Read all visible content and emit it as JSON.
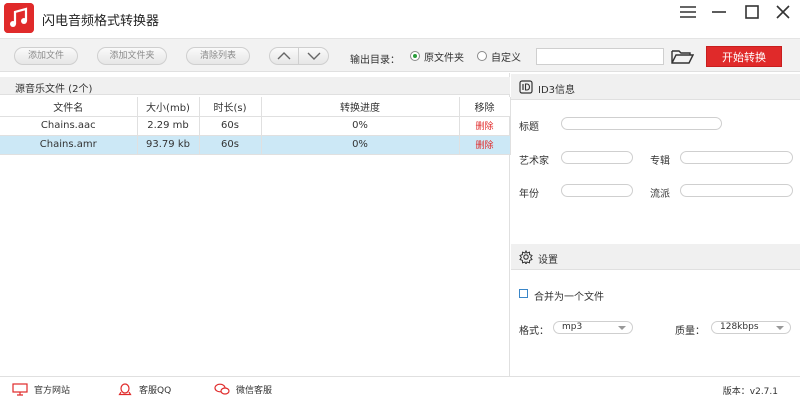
{
  "app": {
    "title": "闪电音频格式转换器"
  },
  "toolbar": {
    "add_file": "添加文件",
    "add_folder": "添加文件夹",
    "clear_list": "清除列表",
    "output_label": "输出目录：",
    "radio_original": "原文件夹",
    "radio_custom": "自定义",
    "radio_selected": "original",
    "path_value": "",
    "start_label": "开始转换"
  },
  "file_list": {
    "title": "源音乐文件 (2个)",
    "columns": [
      "文件名",
      "大小(mb)",
      "时长(s)",
      "转换进度",
      "移除"
    ],
    "rows": [
      {
        "name": "Chains.aac",
        "size": "2.29 mb",
        "duration": "60s",
        "progress": "0%",
        "remove": "删除",
        "selected": false
      },
      {
        "name": "Chains.amr",
        "size": "93.79 kb",
        "duration": "60s",
        "progress": "0%",
        "remove": "删除",
        "selected": true
      }
    ]
  },
  "id3": {
    "title": "ID3信息",
    "title_label": "标题",
    "artist_label": "艺术家",
    "album_label": "专辑",
    "year_label": "年份",
    "genre_label": "流派",
    "title_value": "",
    "artist_value": "",
    "album_value": "",
    "year_value": "",
    "genre_value": ""
  },
  "settings": {
    "title": "设置",
    "merge_label": "合并为一个文件",
    "merge_checked": false,
    "format_label": "格式：",
    "format_value": "mp3",
    "quality_label": "质量：",
    "quality_value": "128kbps"
  },
  "statusbar": {
    "website": "官方网站",
    "qq": "客服QQ",
    "wechat": "微信客服",
    "version": "版本：v2.7.1"
  },
  "colors": {
    "accent": "#e02a2a",
    "selected_row": "#cce8f6",
    "radio_on": "#2a9d3a"
  }
}
